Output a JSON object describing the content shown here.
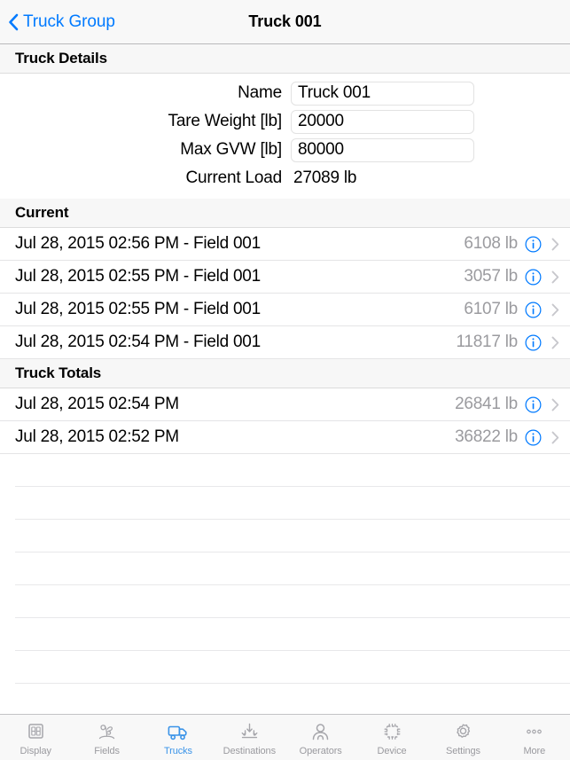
{
  "navbar": {
    "back_label": "Truck Group",
    "back_icon": "chevron-left-icon",
    "title": "Truck 001",
    "accent_color": "#007aff"
  },
  "details": {
    "section_title": "Truck Details",
    "fields": [
      {
        "label": "Name",
        "value": "Truck 001",
        "placeholder": "Name",
        "type": "input"
      },
      {
        "label": "Tare Weight [lb]",
        "value": "20000",
        "placeholder": "Tare Weight",
        "type": "input"
      },
      {
        "label": "Max GVW [lb]",
        "value": "80000",
        "placeholder": "Max GVW",
        "type": "input"
      },
      {
        "label": "Current Load",
        "value": "27089 lb",
        "placeholder": "",
        "type": "static"
      }
    ]
  },
  "current": {
    "section_title": "Current",
    "rows": [
      {
        "title": "Jul 28, 2015 02:56 PM - Field 001",
        "value": "6108 lb",
        "info_icon": "info-circle-icon",
        "chevron": "chevron-right-icon"
      },
      {
        "title": "Jul 28, 2015 02:55 PM - Field 001",
        "value": "3057 lb",
        "info_icon": "info-circle-icon",
        "chevron": "chevron-right-icon"
      },
      {
        "title": "Jul 28, 2015 02:55 PM - Field 001",
        "value": "6107 lb",
        "info_icon": "info-circle-icon",
        "chevron": "chevron-right-icon"
      },
      {
        "title": "Jul 28, 2015 02:54 PM - Field 001",
        "value": "11817 lb",
        "info_icon": "info-circle-icon",
        "chevron": "chevron-right-icon"
      }
    ]
  },
  "truck_totals": {
    "section_title": "Truck Totals",
    "rows": [
      {
        "title": "Jul 28, 2015 02:54 PM",
        "value": "26841 lb",
        "info_icon": "info-circle-icon",
        "chevron": "chevron-right-icon"
      },
      {
        "title": "Jul 28, 2015 02:52 PM",
        "value": "36822 lb",
        "info_icon": "info-circle-icon",
        "chevron": "chevron-right-icon"
      }
    ],
    "empty_row_count": 8
  },
  "tabbar": {
    "active_color": "#3a93e8",
    "inactive_color": "#9a9a9f",
    "items": [
      {
        "label": "Display",
        "icon": "display-icon",
        "active": false
      },
      {
        "label": "Fields",
        "icon": "plant-icon",
        "active": false
      },
      {
        "label": "Trucks",
        "icon": "truck-icon",
        "active": true
      },
      {
        "label": "Destinations",
        "icon": "unload-arrows-icon",
        "active": false
      },
      {
        "label": "Operators",
        "icon": "person-icon",
        "active": false
      },
      {
        "label": "Device",
        "icon": "chip-icon",
        "active": false
      },
      {
        "label": "Settings",
        "icon": "gear-icon",
        "active": false
      },
      {
        "label": "More",
        "icon": "ellipsis-icon",
        "active": false
      }
    ]
  }
}
